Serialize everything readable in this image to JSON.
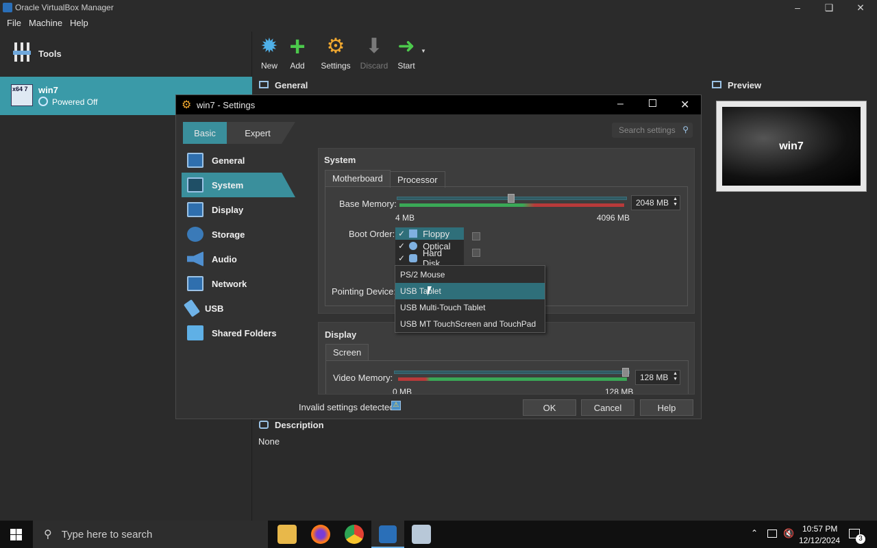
{
  "window": {
    "title": "Oracle VirtualBox Manager"
  },
  "menubar": {
    "items": [
      "File",
      "Machine",
      "Help"
    ]
  },
  "left": {
    "tools_label": "Tools",
    "vm_name": "win7",
    "vm_status": "Powered Off"
  },
  "toolbar": {
    "new": "New",
    "add": "Add",
    "settings": "Settings",
    "discard": "Discard",
    "start": "Start"
  },
  "details": {
    "general": "General",
    "preview": "Preview",
    "preview_vm": "win7",
    "description": "Description",
    "description_value": "None"
  },
  "dialog": {
    "title": "win7 - Settings",
    "mode_tabs": [
      "Basic",
      "Expert"
    ],
    "search_placeholder": "Search settings",
    "nav": [
      "General",
      "System",
      "Display",
      "Storage",
      "Audio",
      "Network",
      "USB",
      "Shared Folders"
    ],
    "selected_nav": "System",
    "system": {
      "section": "System",
      "tabs": [
        "Motherboard",
        "Processor"
      ],
      "base_memory_label": "Base Memory:",
      "base_memory_value": "2048 MB",
      "base_memory_min": "4 MB",
      "base_memory_max": "4096 MB",
      "base_memory_fraction": 0.5,
      "boot_order_label": "Boot Order:",
      "boot_items": [
        "Floppy",
        "Optical",
        "Hard Disk"
      ],
      "pointing_label": "Pointing Device:"
    },
    "display": {
      "section": "Display",
      "tab": "Screen",
      "video_memory_label": "Video Memory:",
      "video_memory_value": "128 MB",
      "video_min": "0 MB",
      "video_max": "128 MB"
    },
    "invalid": "Invalid settings detected",
    "buttons": {
      "ok": "OK",
      "cancel": "Cancel",
      "help": "Help"
    }
  },
  "popup": {
    "options": [
      "PS/2 Mouse",
      "USB Tablet",
      "USB Multi-Touch Tablet",
      "USB MT TouchScreen and TouchPad"
    ],
    "highlighted": "USB Tablet"
  },
  "taskbar": {
    "search_placeholder": "Type here to search",
    "time": "10:57 PM",
    "date": "12/12/2024",
    "notifications": "3"
  }
}
